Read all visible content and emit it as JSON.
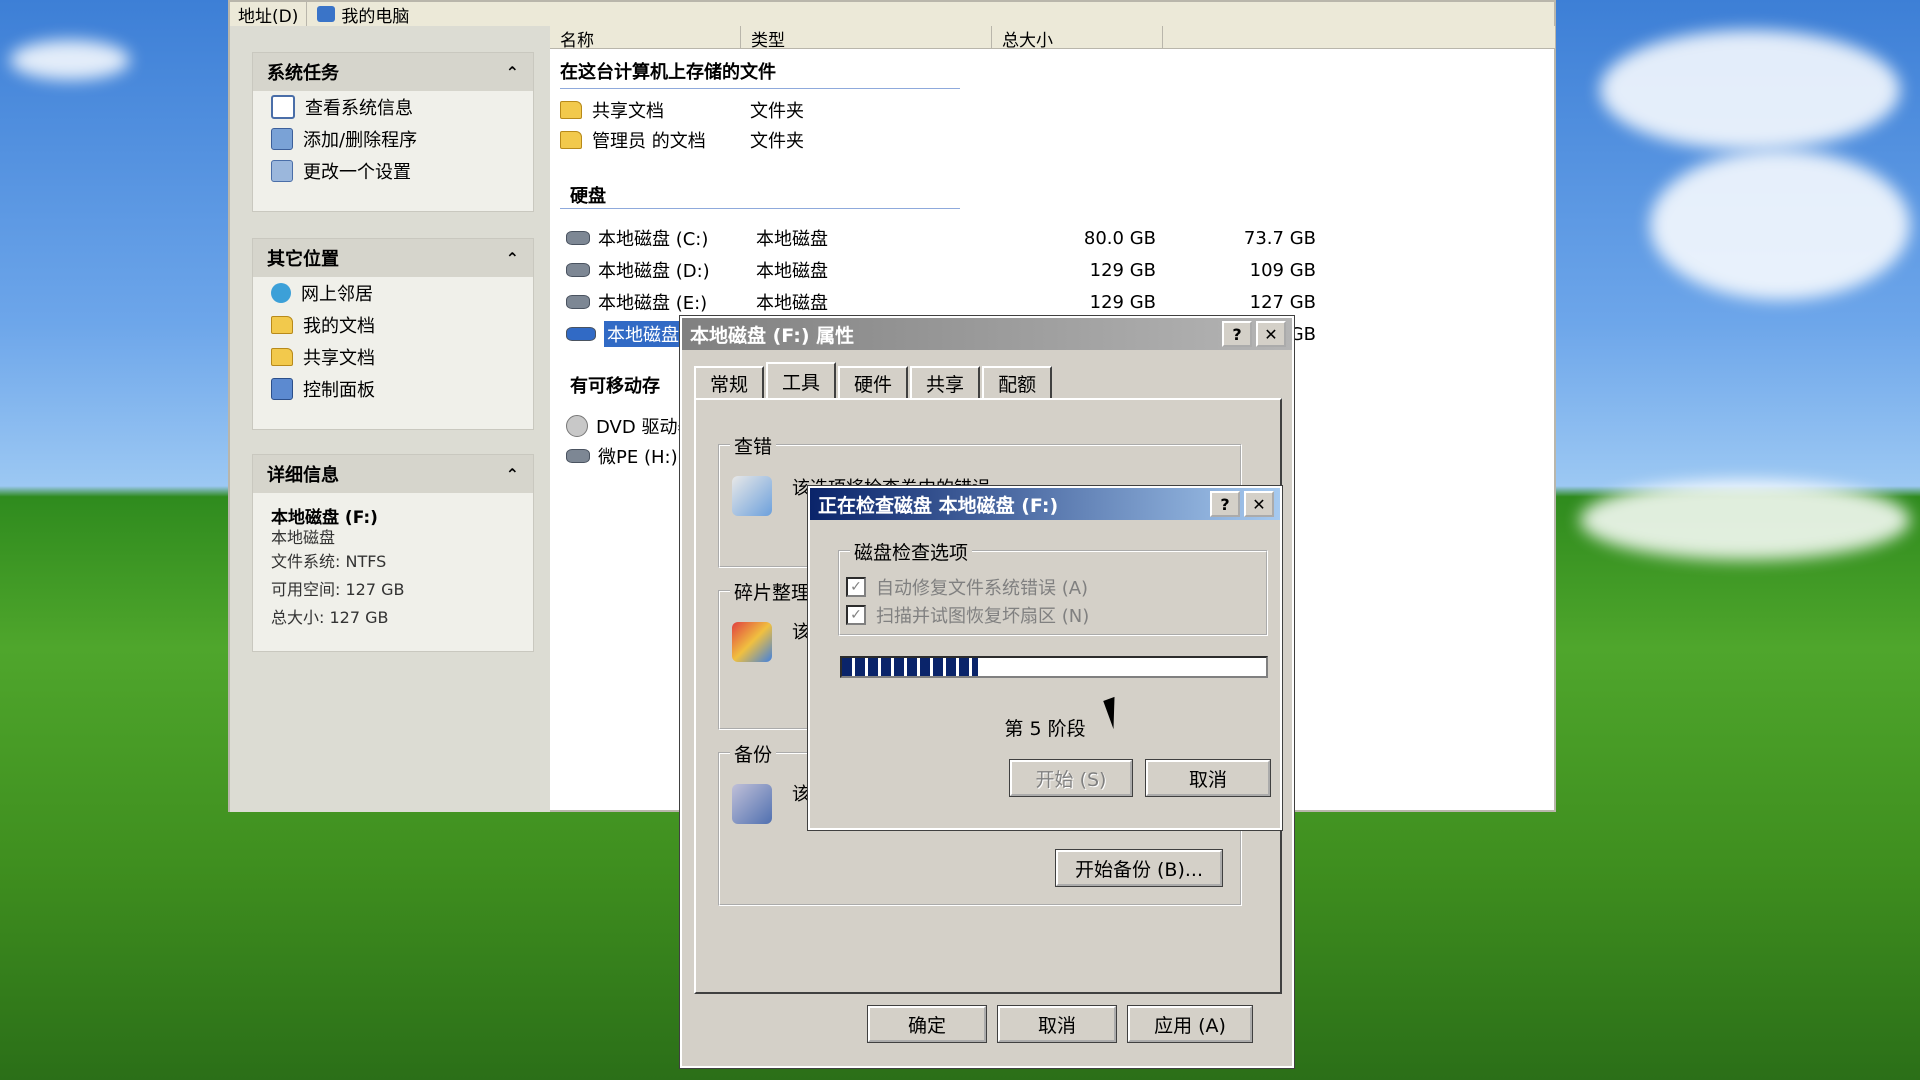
{
  "explorer": {
    "address_label": "地址(D)",
    "address_value": "我的电脑",
    "columns": {
      "name": "名称",
      "type": "类型",
      "total": "总大小"
    },
    "left_pane": {
      "system_tasks": {
        "title": "系统任务",
        "items": [
          "查看系统信息",
          "添加/删除程序",
          "更改一个设置"
        ]
      },
      "other_places": {
        "title": "其它位置",
        "items": [
          "网上邻居",
          "我的文档",
          "共享文档",
          "控制面板"
        ]
      },
      "details": {
        "title": "详细信息",
        "name": "本地磁盘 (F:)",
        "kind": "本地磁盘",
        "fs": "文件系统: NTFS",
        "free": "可用空间: 127 GB",
        "total": "总大小: 127 GB"
      }
    },
    "sections": {
      "stored_files": "在这台计算机上存储的文件",
      "hard_disks": "硬盘",
      "removable": "有可移动存"
    },
    "folders": [
      {
        "name": "共享文档",
        "type": "文件夹"
      },
      {
        "name": "管理员 的文档",
        "type": "文件夹"
      }
    ],
    "disks": [
      {
        "name": "本地磁盘 (C:)",
        "type": "本地磁盘",
        "total": "80.0 GB",
        "free": "73.7 GB"
      },
      {
        "name": "本地磁盘 (D:)",
        "type": "本地磁盘",
        "total": "129 GB",
        "free": "109 GB"
      },
      {
        "name": "本地磁盘 (E:)",
        "type": "本地磁盘",
        "total": "129 GB",
        "free": "127 GB"
      },
      {
        "name": "本地磁盘 (",
        "type": "",
        "total": "",
        "free": "GB"
      }
    ],
    "removable": [
      {
        "name": "DVD 驱动器"
      },
      {
        "name": "微PE (H:)"
      }
    ]
  },
  "properties": {
    "title": "本地磁盘 (F:) 属性",
    "tabs": [
      "常规",
      "工具",
      "硬件",
      "共享",
      "配额"
    ],
    "active_tab": "工具",
    "check_group": "查错",
    "check_desc": "该选项将检查卷中的错误。",
    "defrag_group": "碎片整理",
    "defrag_partial": "该",
    "backup_group": "备份",
    "backup_partial": "该",
    "backup_button": "开始备份 (B)...",
    "ok": "确定",
    "cancel": "取消",
    "apply": "应用 (A)"
  },
  "checkdisk": {
    "title": "正在检查磁盘 本地磁盘 (F:)",
    "options_group": "磁盘检查选项",
    "option1": "自动修复文件系统错误 (A)",
    "option2": "扫描并试图恢复坏扇区 (N)",
    "option1_checked": true,
    "option2_checked": true,
    "progress_fraction": 0.32,
    "phase": "第 5 阶段",
    "start": "开始 (S)",
    "cancel": "取消"
  },
  "titlebar_buttons": {
    "help": "?",
    "close": "✕"
  },
  "colors": {
    "active_title": "#0a246a",
    "inactive_title": "#808080",
    "selection": "#316ac5",
    "dialog_face": "#d4d0c8"
  }
}
